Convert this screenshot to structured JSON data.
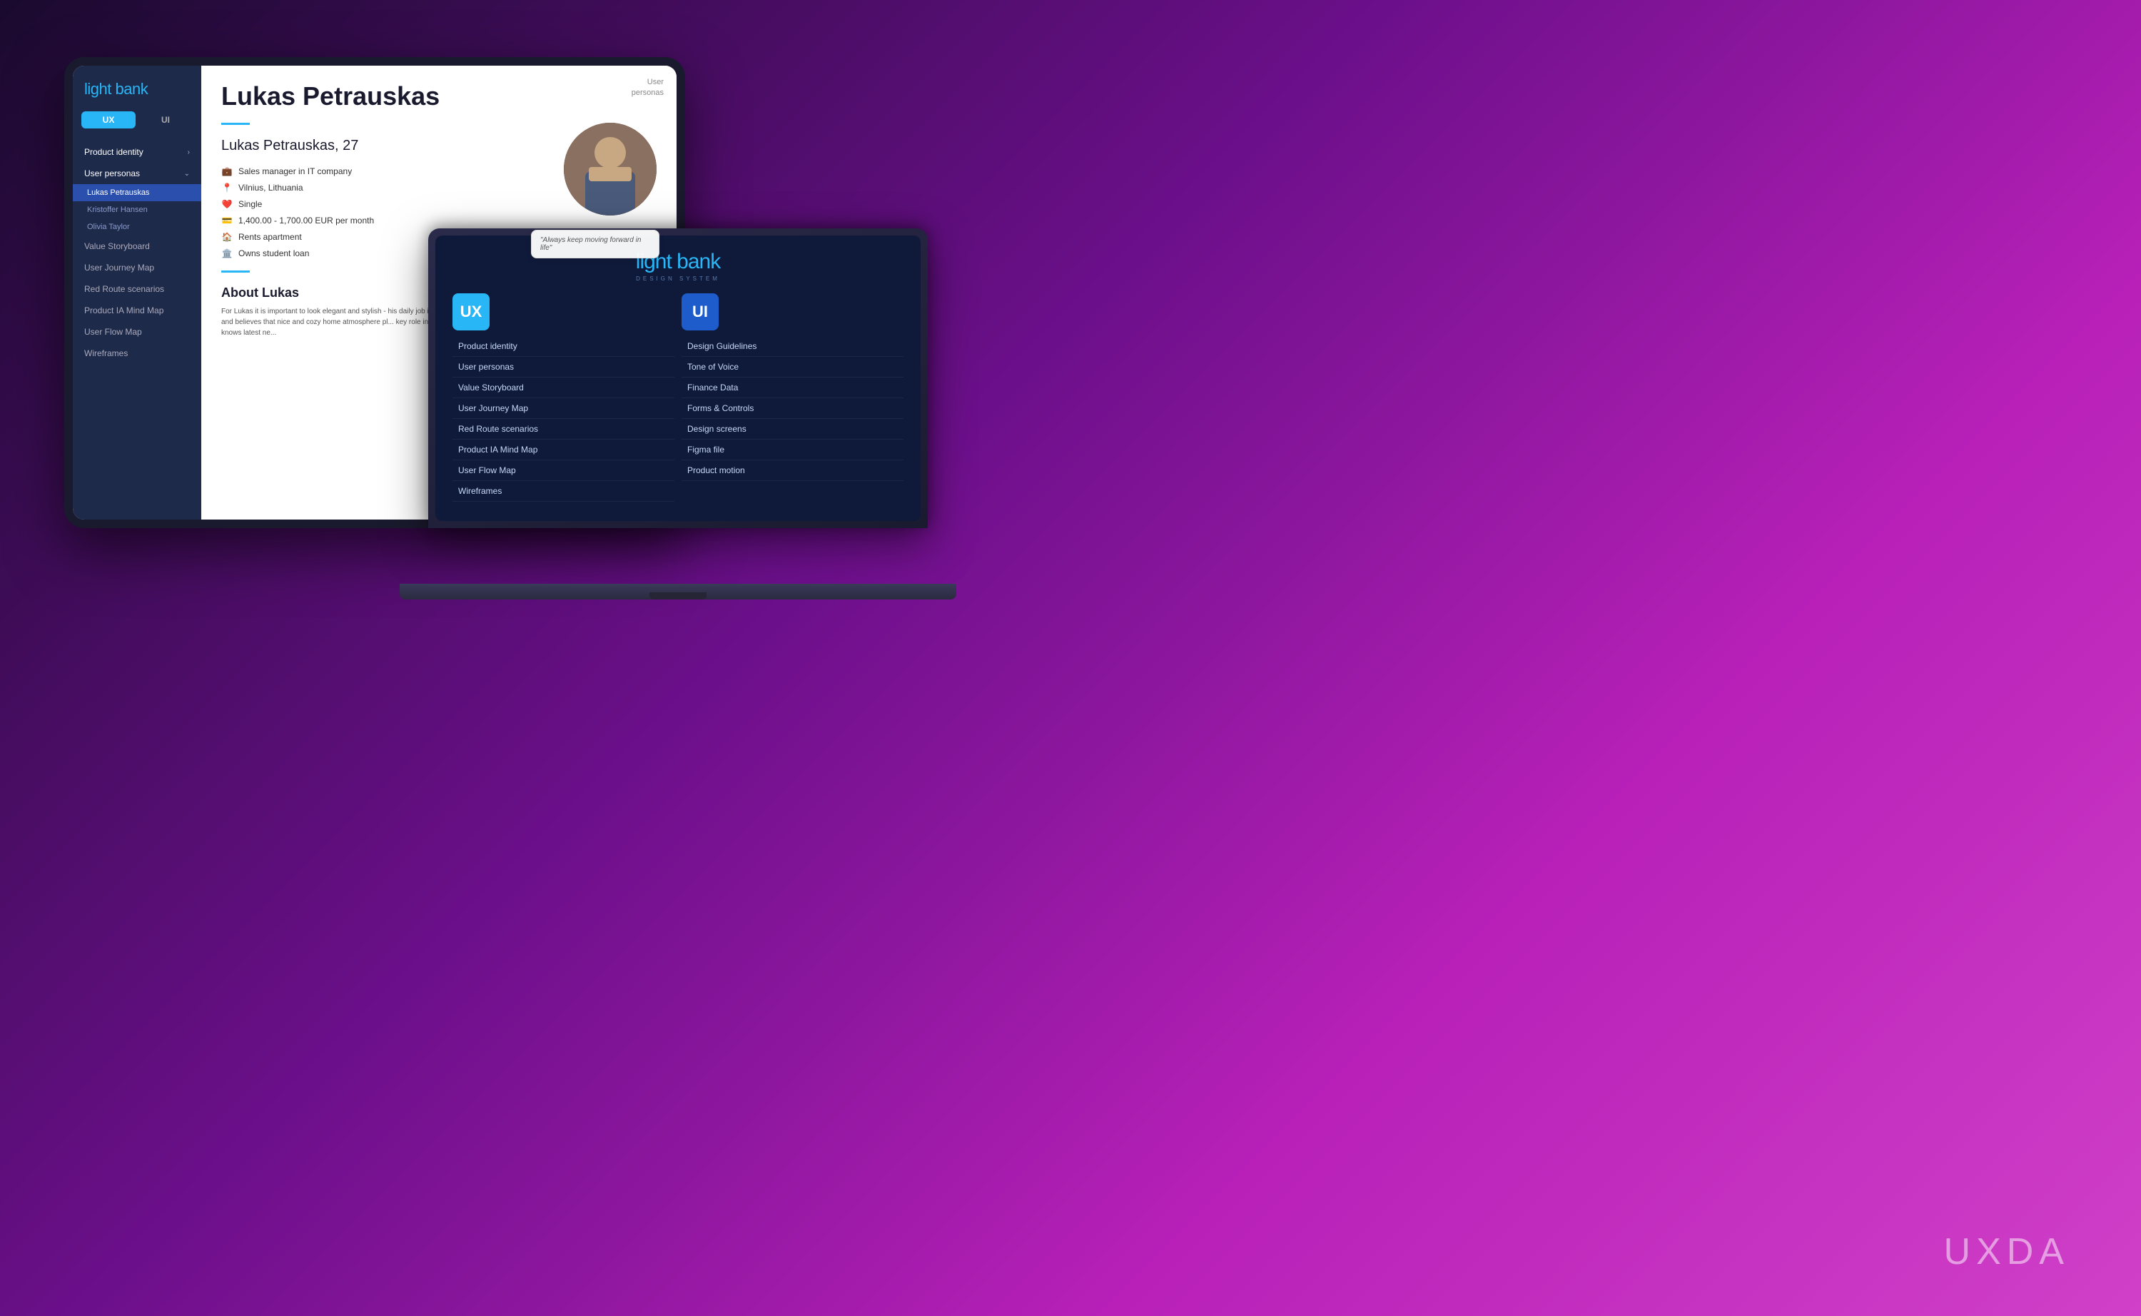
{
  "background": "linear-gradient(135deg, #1a0a2e 0%, #6b0f8a 40%, #c020c0 70%, #d040d0 100%)",
  "watermark": "UXDA",
  "tablet": {
    "logo_prefix": "light ",
    "logo_accent": "bank",
    "tabs": [
      "UX",
      "UI"
    ],
    "active_tab": "UX",
    "sidebar_items": [
      {
        "label": "Product identity",
        "has_chevron": true
      },
      {
        "label": "User personas",
        "expanded": true,
        "has_chevron": true
      },
      {
        "label": "Lukas Petrauskas",
        "sub": true,
        "active": true
      },
      {
        "label": "Kristoffer Hansen",
        "sub": true
      },
      {
        "label": "Olivia Taylor",
        "sub": true
      },
      {
        "label": "Value Storyboard"
      },
      {
        "label": "User Journey Map"
      },
      {
        "label": "Red Route scenarios"
      },
      {
        "label": "Product IA Mind Map"
      },
      {
        "label": "User Flow Map"
      },
      {
        "label": "Wireframes"
      }
    ],
    "breadcrumb_line1": "User",
    "breadcrumb_line2": "personas",
    "main_title": "Lukas Petrauskas",
    "persona_subtitle": "Lukas Petrauskas, 27",
    "info_items": [
      {
        "icon": "briefcase",
        "text": "Sales manager in IT company"
      },
      {
        "icon": "location",
        "text": "Vilnius, Lithuania"
      },
      {
        "icon": "heart",
        "text": "Single"
      },
      {
        "icon": "money",
        "text": "1,400.00 - 1,700.00 EUR per month"
      },
      {
        "icon": "house",
        "text": "Rents apartment"
      },
      {
        "icon": "bank",
        "text": "Owns student loan"
      }
    ],
    "quote": "\"Always keep moving forward in life\"",
    "about_title": "About Lukas",
    "about_text": "For Lukas it is important to look elegant and stylish - his daily job includes a lot of meetings wi... clients. He is also quite pedantic at home and believes that nice and cozy home atmosphere pl... key role in relaxing after workday. Lukas always is the soul of the company, he knows latest ne..."
  },
  "laptop": {
    "logo_prefix": "light ",
    "logo_accent": "bank",
    "logo_sub": "DESIGN SYSTEM",
    "ux_badge": "UX",
    "ui_badge": "UI",
    "ux_items": [
      "Product identity",
      "User personas",
      "Value Storyboard",
      "User Journey Map",
      "Red Route scenarios",
      "Product IA Mind Map",
      "User Flow Map",
      "Wireframes"
    ],
    "ui_items": [
      "Design Guidelines",
      "Tone of Voice",
      "Finance Data",
      "Forms & Controls",
      "Design screens",
      "Figma file",
      "Product motion"
    ]
  }
}
